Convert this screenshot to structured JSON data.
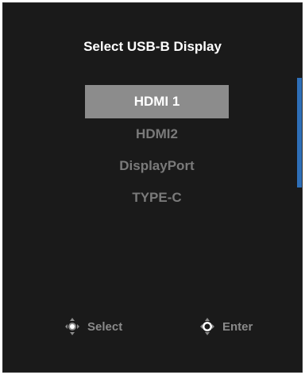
{
  "dialog": {
    "title": "Select USB-B Display"
  },
  "options": [
    {
      "label": "HDMI 1",
      "selected": true
    },
    {
      "label": "HDMI2",
      "selected": false
    },
    {
      "label": "DisplayPort",
      "selected": false
    },
    {
      "label": "TYPE-C",
      "selected": false
    }
  ],
  "hints": {
    "select": {
      "icon": "joystick-up-down-icon",
      "label": "Select"
    },
    "enter": {
      "icon": "joystick-press-icon",
      "label": "Enter"
    }
  },
  "colors": {
    "panel_bg": "#1a1a1a",
    "selected_bg": "#8c8c8c",
    "accent": "#2e6fb8",
    "inactive_text": "#7a7a7a"
  }
}
